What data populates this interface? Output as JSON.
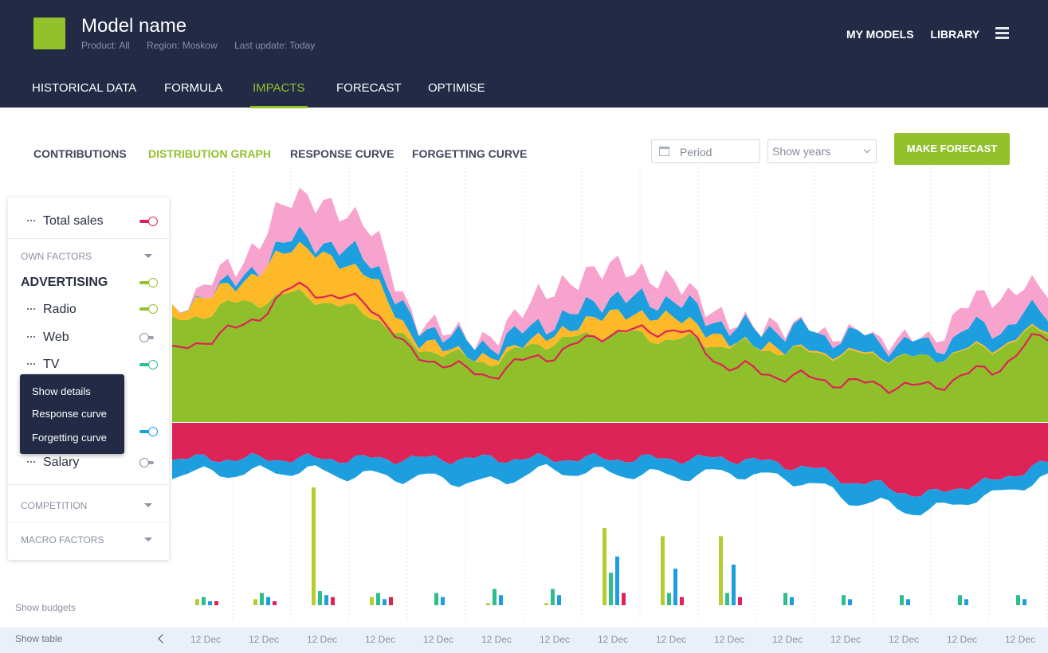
{
  "header": {
    "model_name": "Model name",
    "product": "Product: All",
    "region": "Region: Moskow",
    "last_update": "Last update: Today",
    "nav": [
      "MY MODELS",
      "LIBRARY"
    ],
    "tabs": [
      "HISTORICAL DATA",
      "FORMULA",
      "IMPACTS",
      "FORECAST",
      "OPTIMISE"
    ],
    "active_tab": "IMPACTS"
  },
  "subtabs": [
    "CONTRIBUTIONS",
    "DISTRIBUTION GRAPH",
    "RESPONSE CURVE",
    "FORGETTING CURVE"
  ],
  "active_subtab": "DISTRIBUTION GRAPH",
  "controls": {
    "period_placeholder": "Period",
    "years_value": "Show years",
    "forecast_button": "MAKE FORECAST"
  },
  "panel": {
    "total_sales": "Total sales",
    "own_factors": "OWN FACTORS",
    "advertising": "ADVERTISING",
    "radio": "Radio",
    "web": "Web",
    "tv": "TV",
    "salary": "Salary",
    "competition": "COMPETITION",
    "macro_factors": "MACRO FACTORS",
    "toggles": {
      "total_sales": true,
      "advertising": true,
      "radio": true,
      "web": false,
      "tv": true,
      "hidden_factor": true,
      "salary": false
    }
  },
  "context_menu": [
    "Show details",
    "Response curve",
    "Forgetting curve"
  ],
  "footer": {
    "show_budgets": "Show budgets",
    "show_table": "Show table",
    "date_labels": [
      "12 Dec",
      "12 Dec",
      "12 Dec",
      "12 Dec",
      "12 Dec",
      "12 Dec",
      "12 Dec",
      "12 Dec",
      "12 Dec",
      "12 Dec",
      "12 Dec",
      "12 Dec",
      "12 Dec",
      "12 Dec",
      "12 Dec"
    ]
  },
  "colors": {
    "navy": "#222a45",
    "accent": "#93c12c",
    "pink": "#f8a3cd",
    "orange": "#fdb927",
    "blue": "#1d9fdf",
    "crimson": "#de2359",
    "green": "#8fbf2a",
    "lime": "#b5cc2e",
    "teal": "#2ebd8c",
    "peach": "#f9d08b"
  },
  "chart_data": {
    "type": "area",
    "x": [
      "12 Dec",
      "12 Dec",
      "12 Dec",
      "12 Dec",
      "12 Dec",
      "12 Dec",
      "12 Dec",
      "12 Dec",
      "12 Dec",
      "12 Dec",
      "12 Dec",
      "12 Dec",
      "12 Dec",
      "12 Dec",
      "12 Dec"
    ],
    "series": [
      {
        "color": "#8fbf2a",
        "values": [
          62,
          74,
          80,
          70,
          46,
          38,
          50,
          56,
          52,
          48,
          44,
          42,
          40,
          46,
          58
        ]
      },
      {
        "color": "#fdb927",
        "values": [
          8,
          12,
          30,
          26,
          4,
          2,
          4,
          12,
          14,
          2,
          1,
          1,
          0,
          1,
          1
        ]
      },
      {
        "color": "#1d9fdf",
        "values": [
          0,
          2,
          6,
          10,
          9,
          8,
          8,
          10,
          10,
          9,
          12,
          10,
          8,
          12,
          10
        ]
      },
      {
        "color": "#f8a3cd",
        "values": [
          0,
          10,
          26,
          22,
          3,
          3,
          20,
          20,
          12,
          3,
          2,
          1,
          3,
          20,
          16
        ]
      }
    ],
    "line": {
      "color": "#de2359",
      "values": [
        44,
        58,
        84,
        76,
        40,
        30,
        42,
        56,
        58,
        34,
        28,
        24,
        22,
        32,
        54
      ]
    },
    "negative_series": [
      {
        "color": "#de2359",
        "values": [
          30,
          30,
          30,
          30,
          30,
          30,
          30,
          30,
          30,
          30,
          36,
          50,
          60,
          50,
          34
        ]
      },
      {
        "color": "#1d9fdf",
        "values": [
          12,
          12,
          10,
          14,
          16,
          20,
          10,
          12,
          14,
          12,
          12,
          16,
          14,
          12,
          12
        ]
      }
    ],
    "budgets": [
      {
        "color": "#b5cc2e",
        "values": [
          3,
          3,
          58,
          4,
          0,
          1,
          1,
          38,
          34,
          34,
          0,
          0,
          0,
          0,
          0
        ]
      },
      {
        "color": "#2ebd8c",
        "values": [
          4,
          6,
          7,
          6,
          6,
          8,
          8,
          16,
          6,
          6,
          6,
          5,
          5,
          5,
          5
        ]
      },
      {
        "color": "#1d9fdf",
        "values": [
          2,
          4,
          5,
          3,
          4,
          5,
          5,
          24,
          18,
          20,
          4,
          3,
          3,
          3,
          3
        ]
      },
      {
        "color": "#de2359",
        "values": [
          2,
          2,
          4,
          4,
          0,
          0,
          0,
          6,
          4,
          4,
          0,
          0,
          0,
          0,
          0
        ]
      }
    ]
  }
}
